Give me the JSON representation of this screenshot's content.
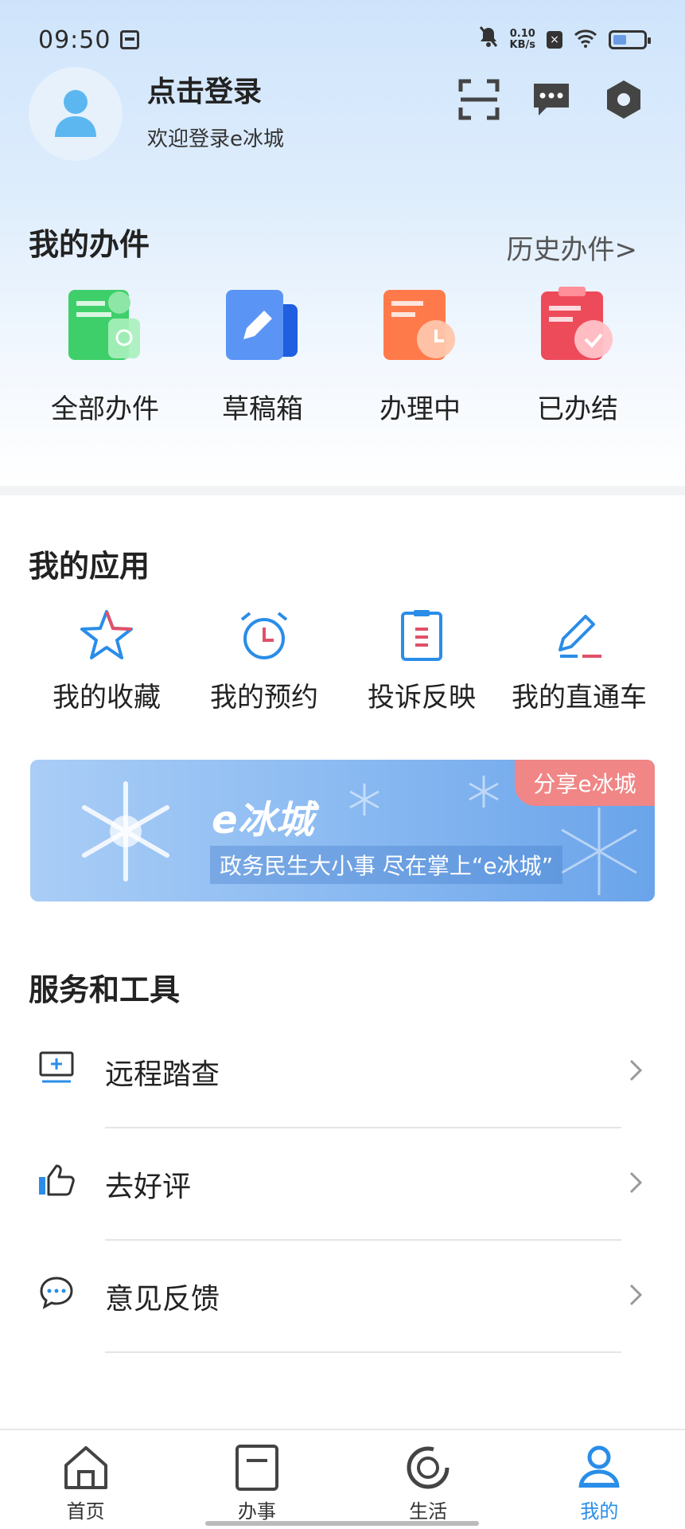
{
  "status_bar": {
    "time": "09:50",
    "net_speed_value": "0.10",
    "net_speed_unit": "KB/s",
    "icons": [
      "calendar-icon",
      "mute-icon",
      "network-speed",
      "x-badge-icon",
      "wifi-icon",
      "battery-icon"
    ]
  },
  "header": {
    "login_title": "点击登录",
    "login_subtitle": "欢迎登录e冰城",
    "icons": [
      "scan-icon",
      "message-icon",
      "settings-icon"
    ]
  },
  "my_cases": {
    "title": "我的办件",
    "history_link": "历史办件>",
    "items": [
      {
        "label": "全部办件",
        "icon": "all-cases-icon",
        "color": "#3fcf6a"
      },
      {
        "label": "草稿箱",
        "icon": "draft-icon",
        "color": "#3a7ff0"
      },
      {
        "label": "办理中",
        "icon": "processing-icon",
        "color": "#ff7a4a"
      },
      {
        "label": "已办结",
        "icon": "completed-icon",
        "color": "#ee4b5a"
      }
    ]
  },
  "my_apps": {
    "title": "我的应用",
    "items": [
      {
        "label": "我的收藏",
        "icon": "star-icon"
      },
      {
        "label": "我的预约",
        "icon": "alarm-clock-icon"
      },
      {
        "label": "投诉反映",
        "icon": "clipboard-icon"
      },
      {
        "label": "我的直通车",
        "icon": "pen-icon"
      }
    ]
  },
  "banner": {
    "share_label": "分享e冰城",
    "brand": "e冰城",
    "slogan": "政务民生大小事 尽在掌上“e冰城”"
  },
  "services": {
    "title": "服务和工具",
    "items": [
      {
        "label": "远程踏查",
        "icon": "remote-inspect-icon"
      },
      {
        "label": "去好评",
        "icon": "thumbs-up-icon"
      },
      {
        "label": "意见反馈",
        "icon": "feedback-chat-icon"
      }
    ]
  },
  "tabbar": {
    "items": [
      {
        "label": "首页",
        "icon": "home-icon",
        "active": false
      },
      {
        "label": "办事",
        "icon": "affairs-icon",
        "active": false
      },
      {
        "label": "生活",
        "icon": "life-icon",
        "active": false
      },
      {
        "label": "我的",
        "icon": "profile-icon",
        "active": true
      }
    ]
  },
  "colors": {
    "accent": "#2a8de8",
    "banner_share": "#f08686"
  }
}
